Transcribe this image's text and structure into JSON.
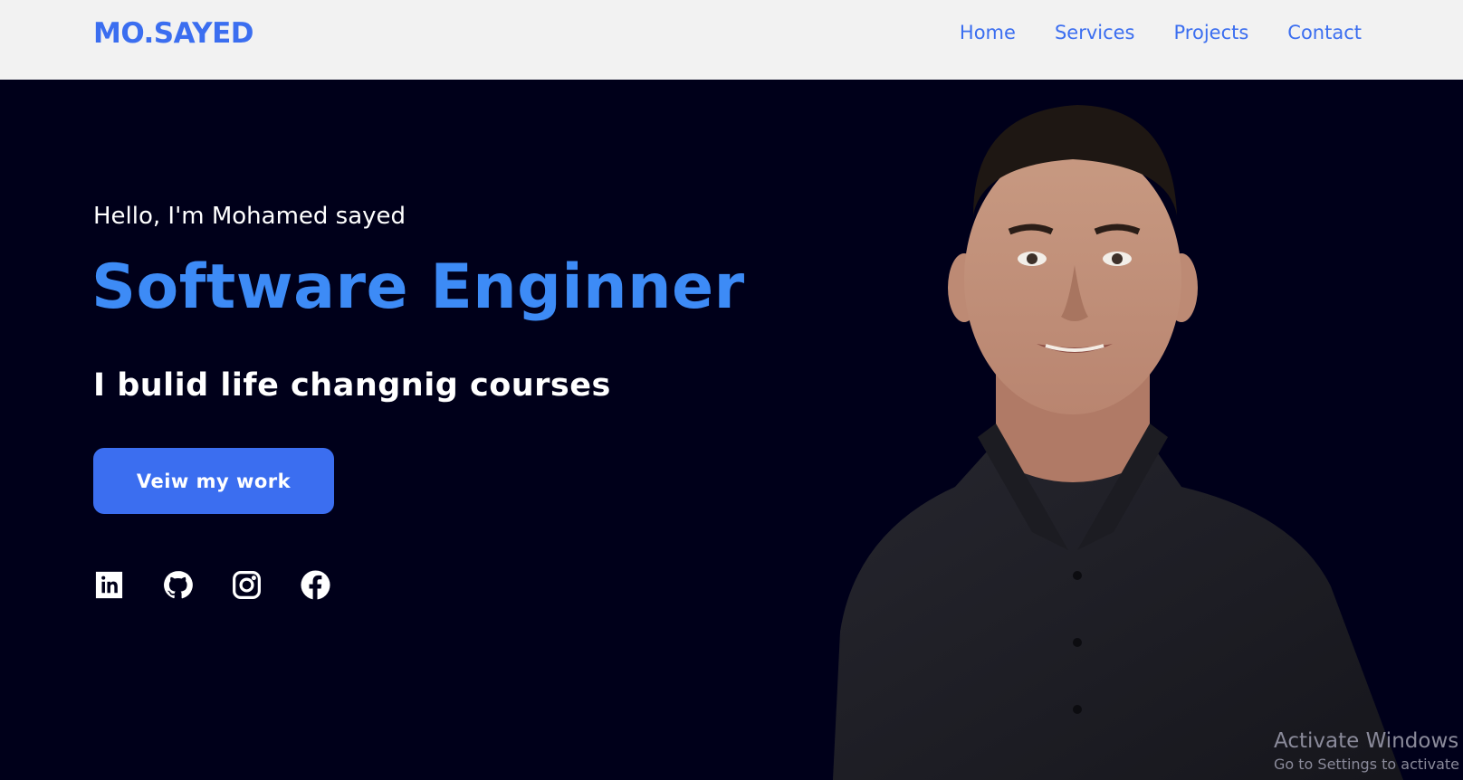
{
  "brand": {
    "logo": "MO.SAYED"
  },
  "nav": {
    "items": [
      "Home",
      "Services",
      "Projects",
      "Contact"
    ]
  },
  "hero": {
    "greeting": "Hello, I'm Mohamed sayed",
    "title": "Software Enginner",
    "subtitle": "I bulid life changnig courses",
    "cta_label": "Veiw my work",
    "socials": [
      "linkedin-icon",
      "github-icon",
      "instagram-icon",
      "facebook-icon"
    ],
    "portrait_icon": "person-portrait-photo"
  },
  "watermark": {
    "title": "Activate Windows",
    "subtitle": "Go to Settings to activate Windows."
  },
  "colors": {
    "accent": "#3b6ef0",
    "title": "#3d8bf6",
    "hero_bg": "#00001a",
    "nav_bg": "#f2f2f2"
  }
}
